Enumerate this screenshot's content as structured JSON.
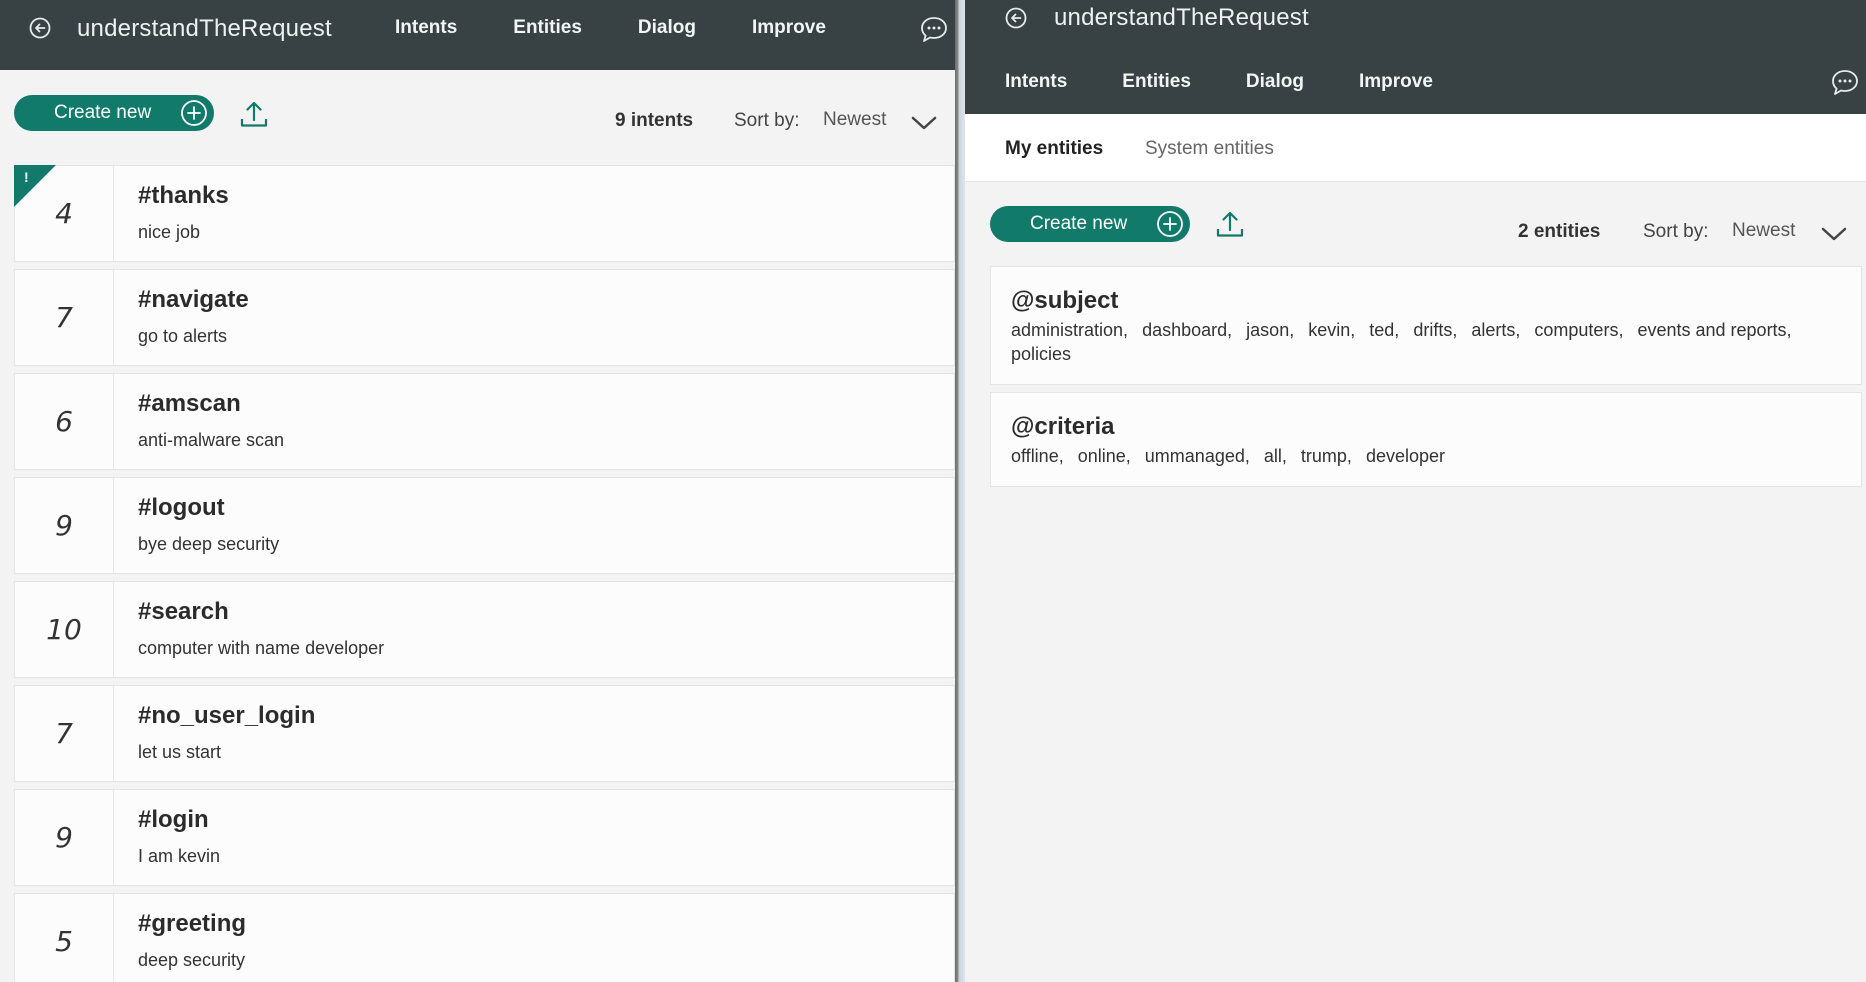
{
  "left": {
    "header": {
      "title": "understandTheRequest",
      "nav": [
        "Intents",
        "Entities",
        "Dialog",
        "Improve"
      ]
    },
    "toolbar": {
      "create_label": "Create new",
      "count_label": "9 intents",
      "sort_label": "Sort by:",
      "sort_value": "Newest"
    },
    "intents": [
      {
        "count": "4",
        "name": "#thanks",
        "example": "nice job",
        "flag": "!"
      },
      {
        "count": "7",
        "name": "#navigate",
        "example": "go to alerts"
      },
      {
        "count": "6",
        "name": "#amscan",
        "example": "anti-malware scan"
      },
      {
        "count": "9",
        "name": "#logout",
        "example": "bye deep security"
      },
      {
        "count": "10",
        "name": "#search",
        "example": "computer with name developer"
      },
      {
        "count": "7",
        "name": "#no_user_login",
        "example": "let us start"
      },
      {
        "count": "9",
        "name": "#login",
        "example": "I am kevin"
      },
      {
        "count": "5",
        "name": "#greeting",
        "example": "deep security"
      }
    ]
  },
  "right": {
    "header": {
      "title": "understandTheRequest",
      "nav": [
        "Intents",
        "Entities",
        "Dialog",
        "Improve"
      ]
    },
    "tabs": [
      "My entities",
      "System entities"
    ],
    "toolbar": {
      "create_label": "Create new",
      "count_label": "2 entities",
      "sort_label": "Sort by:",
      "sort_value": "Newest"
    },
    "entities": [
      {
        "name": "@subject",
        "values": [
          "administration,",
          "dashboard,",
          "jason,",
          "kevin,",
          "ted,",
          "drifts,",
          "alerts,",
          "computers,",
          "events and reports,",
          "policies"
        ]
      },
      {
        "name": "@criteria",
        "values": [
          "offline,",
          "online,",
          "ummanaged,",
          "all,",
          "trump,",
          "developer"
        ]
      }
    ]
  },
  "colors": {
    "header_bg": "#384244",
    "accent": "#127a6a",
    "page_bg": "#f3f3f3"
  },
  "icons": [
    "back-arrow-icon",
    "chat-icon",
    "plus-circle-icon",
    "upload-icon",
    "chevron-down-icon"
  ]
}
